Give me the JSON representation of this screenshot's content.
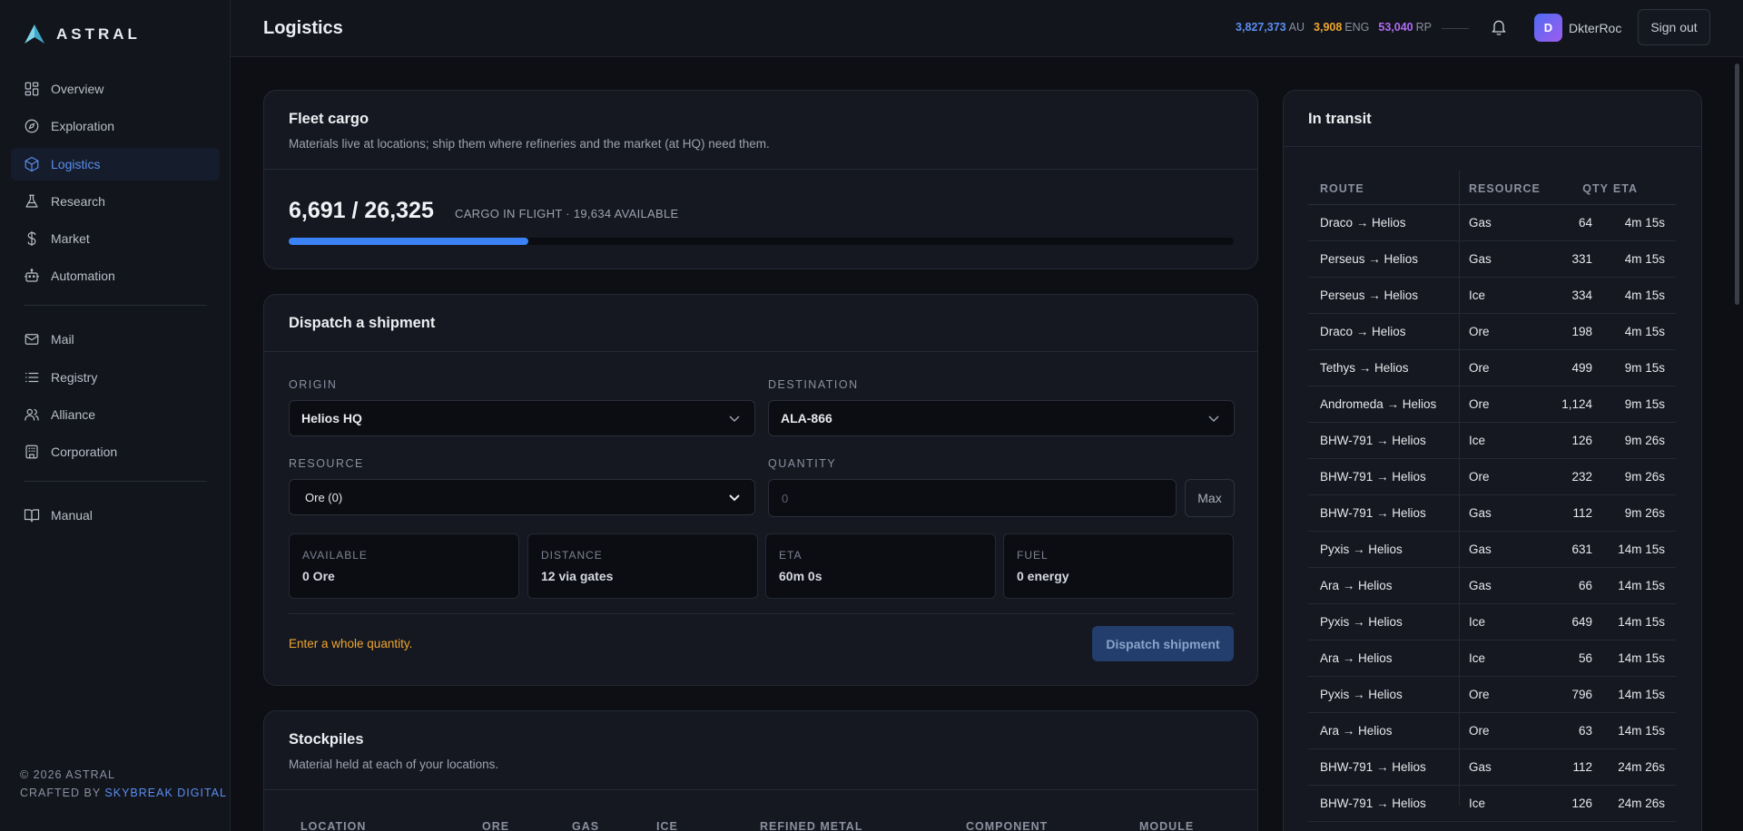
{
  "brand": {
    "name": "ASTRAL"
  },
  "nav": {
    "primary": [
      {
        "label": "Overview",
        "icon": "grid-icon"
      },
      {
        "label": "Exploration",
        "icon": "compass-icon"
      },
      {
        "label": "Logistics",
        "icon": "box-icon",
        "active": true
      },
      {
        "label": "Research",
        "icon": "flask-icon"
      },
      {
        "label": "Market",
        "icon": "dollar-icon"
      },
      {
        "label": "Automation",
        "icon": "robot-icon"
      }
    ],
    "secondary": [
      {
        "label": "Mail",
        "icon": "mail-icon"
      },
      {
        "label": "Registry",
        "icon": "list-icon"
      },
      {
        "label": "Alliance",
        "icon": "users-icon"
      },
      {
        "label": "Corporation",
        "icon": "building-icon"
      }
    ],
    "tertiary": [
      {
        "label": "Manual",
        "icon": "book-icon"
      }
    ]
  },
  "footer": {
    "copyright": "© 2026 ASTRAL",
    "crafted_prefix": "CRAFTED BY ",
    "crafted_link": "SKYBREAK DIGITAL"
  },
  "header": {
    "title": "Logistics",
    "resources": [
      {
        "value": "3,827,373",
        "unit": "AU",
        "color": "#5b8ef0"
      },
      {
        "value": "3,908",
        "unit": "ENG",
        "color": "#f0a630"
      },
      {
        "value": "53,040",
        "unit": "RP",
        "color": "#b06cf2"
      }
    ],
    "avatar_letter": "D",
    "username": "DkterRoc",
    "signout_label": "Sign out"
  },
  "fleet_cargo": {
    "title": "Fleet cargo",
    "subtitle": "Materials live at locations; ship them where refineries and the market (at HQ) need them.",
    "in_flight": "6,691 / 26,325",
    "meta": "CARGO IN FLIGHT · 19,634 AVAILABLE",
    "fill_fraction": 0.254
  },
  "dispatch": {
    "title": "Dispatch a shipment",
    "origin_label": "ORIGIN",
    "origin_value": "Helios HQ",
    "destination_label": "DESTINATION",
    "destination_value": "ALA-866",
    "resource_label": "RESOURCE",
    "resource_value": "Ore (0)",
    "quantity_label": "QUANTITY",
    "quantity_placeholder": "0",
    "max_label": "Max",
    "stats": [
      {
        "key": "AVAILABLE",
        "value": "0 Ore"
      },
      {
        "key": "DISTANCE",
        "value": "12 via gates"
      },
      {
        "key": "ETA",
        "value": "60m 0s"
      },
      {
        "key": "FUEL",
        "value": "0 energy"
      }
    ],
    "warning": "Enter a whole quantity.",
    "submit_label": "Dispatch shipment"
  },
  "stockpiles": {
    "title": "Stockpiles",
    "subtitle": "Material held at each of your locations.",
    "columns": [
      "LOCATION",
      "ORE",
      "GAS",
      "ICE",
      "REFINED METAL",
      "COMPONENT",
      "MODULE"
    ]
  },
  "in_transit": {
    "title": "In transit",
    "columns": {
      "route": "ROUTE",
      "resource": "RESOURCE",
      "qty": "QTY",
      "eta": "ETA"
    },
    "rows": [
      {
        "route": "Draco → Helios",
        "resource": "Gas",
        "qty": "64",
        "eta": "4m 15s"
      },
      {
        "route": "Perseus → Helios",
        "resource": "Gas",
        "qty": "331",
        "eta": "4m 15s"
      },
      {
        "route": "Perseus → Helios",
        "resource": "Ice",
        "qty": "334",
        "eta": "4m 15s"
      },
      {
        "route": "Draco → Helios",
        "resource": "Ore",
        "qty": "198",
        "eta": "4m 15s"
      },
      {
        "route": "Tethys → Helios",
        "resource": "Ore",
        "qty": "499",
        "eta": "9m 15s"
      },
      {
        "route": "Andromeda → Helios",
        "resource": "Ore",
        "qty": "1,124",
        "eta": "9m 15s"
      },
      {
        "route": "BHW-791 → Helios",
        "resource": "Ice",
        "qty": "126",
        "eta": "9m 26s"
      },
      {
        "route": "BHW-791 → Helios",
        "resource": "Ore",
        "qty": "232",
        "eta": "9m 26s"
      },
      {
        "route": "BHW-791 → Helios",
        "resource": "Gas",
        "qty": "112",
        "eta": "9m 26s"
      },
      {
        "route": "Pyxis → Helios",
        "resource": "Gas",
        "qty": "631",
        "eta": "14m 15s"
      },
      {
        "route": "Ara → Helios",
        "resource": "Gas",
        "qty": "66",
        "eta": "14m 15s"
      },
      {
        "route": "Pyxis → Helios",
        "resource": "Ice",
        "qty": "649",
        "eta": "14m 15s"
      },
      {
        "route": "Ara → Helios",
        "resource": "Ice",
        "qty": "56",
        "eta": "14m 15s"
      },
      {
        "route": "Pyxis → Helios",
        "resource": "Ore",
        "qty": "796",
        "eta": "14m 15s"
      },
      {
        "route": "Ara → Helios",
        "resource": "Ore",
        "qty": "63",
        "eta": "14m 15s"
      },
      {
        "route": "BHW-791 → Helios",
        "resource": "Gas",
        "qty": "112",
        "eta": "24m 26s"
      },
      {
        "route": "BHW-791 → Helios",
        "resource": "Ice",
        "qty": "126",
        "eta": "24m 26s"
      }
    ]
  }
}
